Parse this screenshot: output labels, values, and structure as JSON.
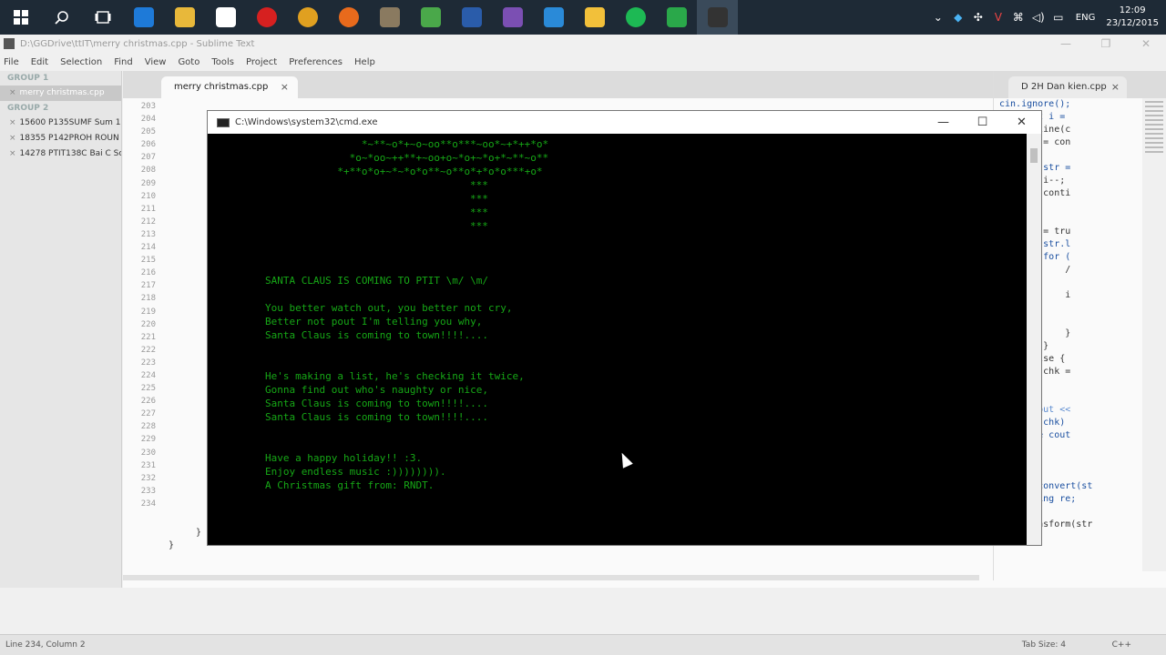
{
  "taskbar": {
    "apps": [
      {
        "name": "edge-icon",
        "color": "#1e7ad8"
      },
      {
        "name": "file-explorer-icon",
        "color": "#e8b83a"
      },
      {
        "name": "store-icon",
        "color": "#ffffff"
      },
      {
        "name": "opera-icon",
        "color": "#d62020"
      },
      {
        "name": "chrome-icon",
        "color": "#e0a020"
      },
      {
        "name": "firefox-icon",
        "color": "#e86a1c"
      },
      {
        "name": "app-icon",
        "color": "#8a7a60"
      },
      {
        "name": "notepad-icon",
        "color": "#4aa84a"
      },
      {
        "name": "word-icon",
        "color": "#2a5caa"
      },
      {
        "name": "visual-studio-icon",
        "color": "#7b4fb3"
      },
      {
        "name": "photoshop-icon",
        "color": "#2a8ad8"
      },
      {
        "name": "cloud-icon",
        "color": "#f2c03a"
      },
      {
        "name": "spotify-icon",
        "color": "#1db954"
      },
      {
        "name": "camtasia-icon",
        "color": "#2aa84a"
      },
      {
        "name": "cmd-icon",
        "color": "#333333"
      }
    ],
    "tray": {
      "language": "ENG",
      "time": "12:09",
      "date": "23/12/2015"
    }
  },
  "sublime": {
    "title": "D:\\GGDrive\\ttIT\\merry christmas.cpp - Sublime Text",
    "menu": [
      "File",
      "Edit",
      "Selection",
      "Find",
      "View",
      "Goto",
      "Tools",
      "Project",
      "Preferences",
      "Help"
    ],
    "sidebar": {
      "group1": "GROUP 1",
      "group1_items": [
        "merry christmas.cpp"
      ],
      "group2": "GROUP 2",
      "group2_items": [
        "15600 P135SUMF Sum 1",
        "18355 P142PROH ROUN",
        "14278 PTIT138C Bai C Sc"
      ]
    },
    "tab_left": "merry christmas.cpp",
    "tab_right": "D 2H Dan kien.cpp",
    "line_numbers": [
      "203",
      "204",
      "205",
      "206",
      "207",
      "208",
      "209",
      "210",
      "211",
      "212",
      "213",
      "214",
      "215",
      "216",
      "217",
      "218",
      "219",
      "220",
      "221",
      "222",
      "223",
      "224",
      "225",
      "226",
      "227",
      "228",
      "229",
      "230",
      "231",
      "232",
      "233",
      "234"
    ],
    "code_left": [
      "}",
      "}"
    ],
    "right_code": [
      "cin.ignore();",
      "for (int i =",
      "    getline(c",
      "    str = con",
      "",
      "    if (str =",
      "        i--;",
      "        conti",
      "    }",
      "",
      "    chk = tru",
      "    if (str.l",
      "        for (",
      "            /",
      "",
      "            i",
      "",
      "",
      "            }",
      "        }",
      "    } else {",
      "        chk =",
      "    }",
      "",
      "    //cout <<",
      "    if (chk)",
      "    else cout",
      "}",
      "",
      "",
      "string convert(st",
      "    string re;",
      "",
      "    transform(str"
    ],
    "status_left": "Line 234, Column 2",
    "status_tab": "Tab Size: 4",
    "status_syntax": "C++"
  },
  "cmd": {
    "title": "C:\\Windows\\system32\\cmd.exe",
    "lines": [
      {
        "text": "*~**~o*+~o~oo**o***~oo*~+*++*o*",
        "col": 12
      },
      {
        "text": "*o~*oo~++**+~oo+o~*o+~*o+*~**~o**",
        "col": 11
      },
      {
        "text": "*+**o*o+~*~*o*o**~o**o*+*o*o***+o*",
        "col": 10
      },
      {
        "text": "***",
        "col": 21
      },
      {
        "text": "***",
        "col": 21
      },
      {
        "text": "***",
        "col": 21
      },
      {
        "text": "***",
        "col": 21
      },
      {
        "text": "",
        "col": 0
      },
      {
        "text": "",
        "col": 0
      },
      {
        "text": "",
        "col": 0
      },
      {
        "text": "SANTA CLAUS IS COMING TO PTIT \\m/ \\m/",
        "col": 4
      },
      {
        "text": "",
        "col": 0
      },
      {
        "text": "You better watch out, you better not cry,",
        "col": 4
      },
      {
        "text": "Better not pout I'm telling you why,",
        "col": 4
      },
      {
        "text": "Santa Claus is coming to town!!!!....",
        "col": 4
      },
      {
        "text": "",
        "col": 0
      },
      {
        "text": "",
        "col": 0
      },
      {
        "text": "He's making a list, he's checking it twice,",
        "col": 4
      },
      {
        "text": "Gonna find out who's naughty or nice,",
        "col": 4
      },
      {
        "text": "Santa Claus is coming to town!!!!....",
        "col": 4
      },
      {
        "text": "Santa Claus is coming to town!!!!....",
        "col": 4
      },
      {
        "text": "",
        "col": 0
      },
      {
        "text": "",
        "col": 0
      },
      {
        "text": "Have a happy holiday!! :3.",
        "col": 4
      },
      {
        "text": "Enjoy endless music :)))))))).",
        "col": 4
      },
      {
        "text": "A Christmas gift from: RNDT.",
        "col": 4
      }
    ]
  }
}
